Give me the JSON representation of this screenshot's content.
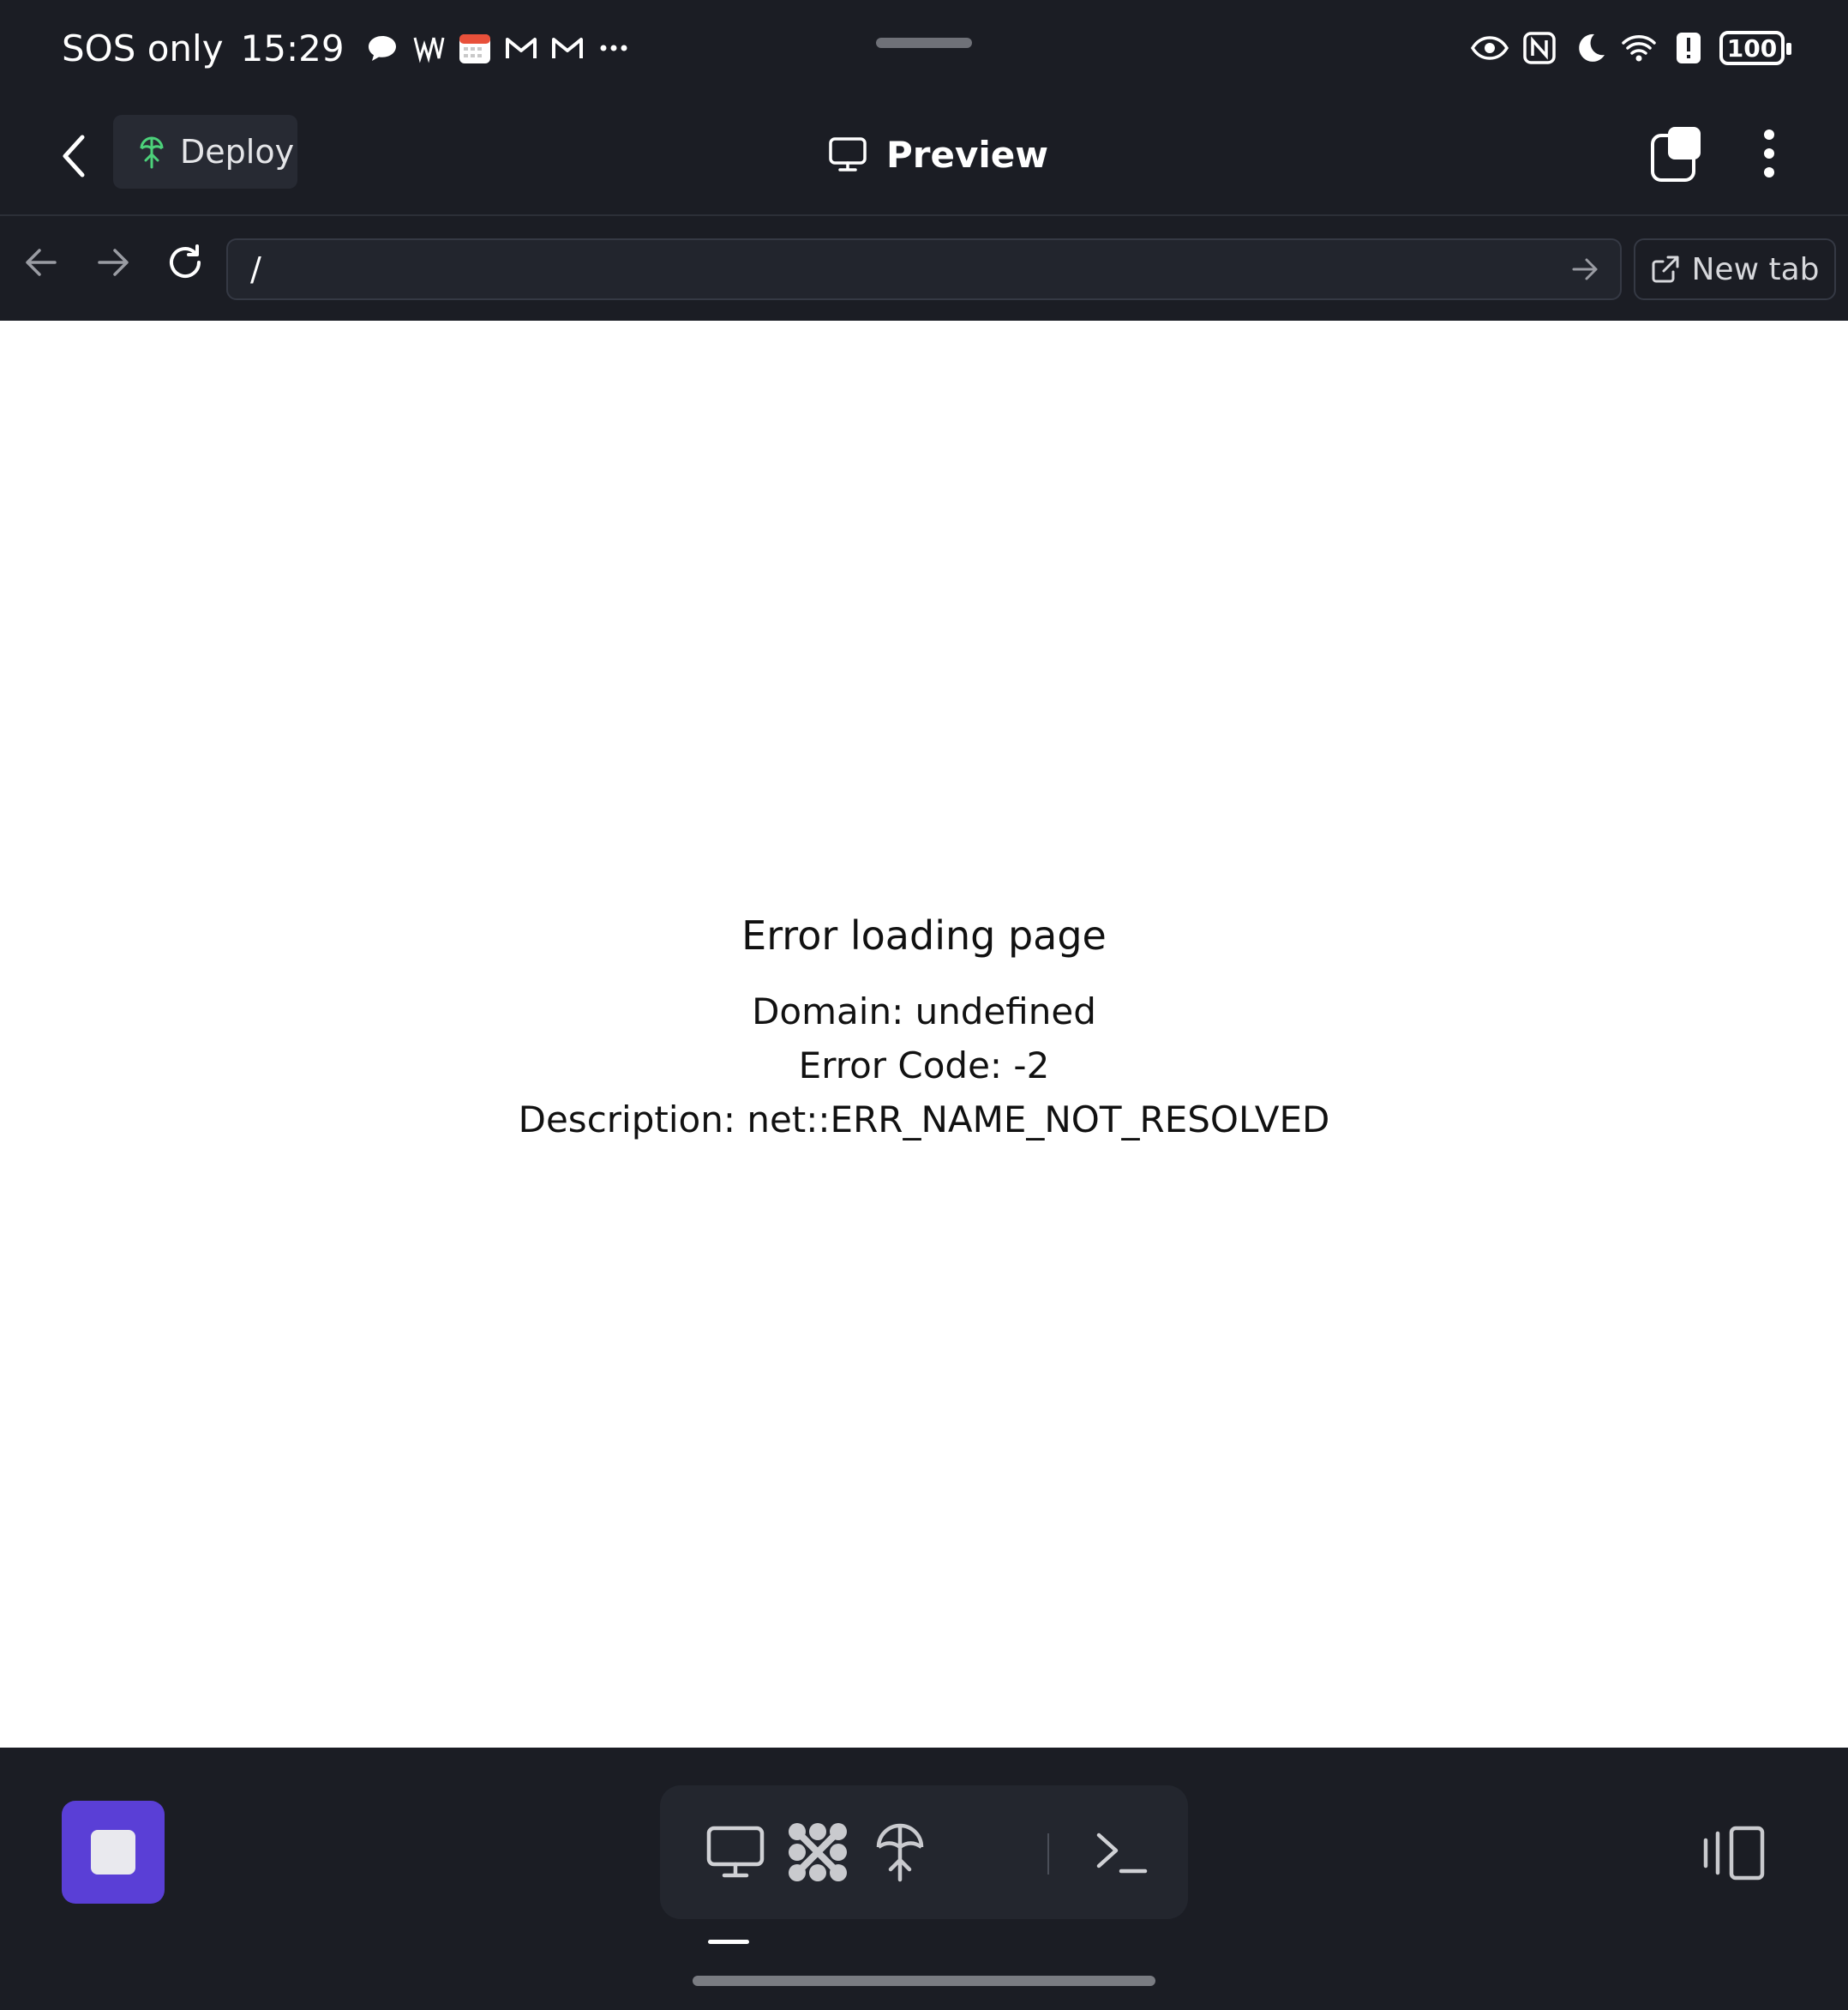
{
  "status_bar": {
    "carrier": "SOS only",
    "time": "15:29",
    "notification_icons": [
      "chat-bubble-icon",
      "w-app-icon",
      "calendar-icon",
      "gmail-icon",
      "gmail-icon",
      "more-dots-icon"
    ],
    "system_icons": [
      "eye-icon",
      "nfc-icon",
      "moon-icon",
      "wifi-icon",
      "alert-icon"
    ],
    "battery": "100"
  },
  "header": {
    "deploy_label": "Deploy",
    "title": "Preview"
  },
  "address_bar": {
    "url": "/",
    "new_tab_label": "New tab"
  },
  "error_page": {
    "title": "Error loading page",
    "domain": "Domain: undefined",
    "code": "Error Code: -2",
    "description": "Description: net::ERR_NAME_NOT_RESOLVED"
  },
  "toolbar": {
    "tools": [
      "preview-monitor-icon",
      "workflow-icon",
      "deploy-icon",
      "terminal-icon"
    ]
  },
  "colors": {
    "background": "#1b1d24",
    "accent": "#5a3fd6",
    "deploy_icon": "#4cd17a"
  }
}
